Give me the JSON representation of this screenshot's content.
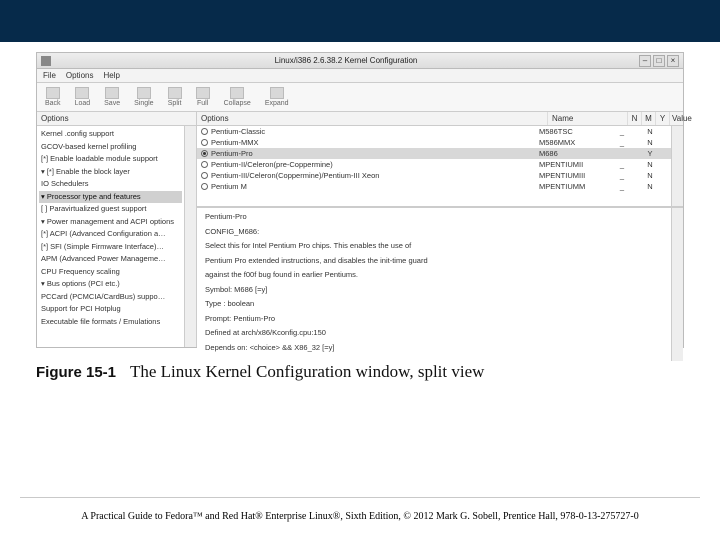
{
  "caption": {
    "figno": "Figure 15-1",
    "text": "The Linux Kernel Configuration window, split view"
  },
  "footer": "A Practical Guide to Fedora™ and Red Hat® Enterprise Linux®, Sixth Edition, © 2012 Mark G. Sobell, Prentice Hall, 978-0-13-275727-0",
  "window": {
    "title": "Linux/i386 2.6.38.2 Kernel Configuration",
    "menus": {
      "file": "File",
      "options": "Options",
      "help": "Help"
    },
    "toolbar": {
      "back": "Back",
      "load": "Load",
      "save": "Save",
      "single": "Single",
      "split": "Split",
      "full": "Full",
      "collapse": "Collapse",
      "expand": "Expand"
    },
    "left": {
      "header": "Options",
      "items": [
        "Kernel .config support",
        "GCOV-based kernel profiling",
        "[*] Enable loadable module support",
        "▾ [*] Enable the block layer",
        "    IO Schedulers",
        "▾ Processor type and features",
        "    [ ] Paravirtualized guest support",
        "▾ Power management and ACPI options",
        "    [*] ACPI (Advanced Configuration a…",
        "    [*] SFI (Simple Firmware Interface)…",
        "    APM (Advanced Power Manageme…",
        "    CPU Frequency scaling",
        "▾ Bus options (PCI etc.)",
        "    PCCard (PCMCIA/CardBus) suppo…",
        "    Support for PCI Hotplug",
        "Executable file formats / Emulations"
      ],
      "selected_index": 5
    },
    "right": {
      "header": {
        "options": "Options",
        "name": "Name",
        "n": "N",
        "m": "M",
        "y": "Y",
        "value": "Value"
      },
      "rows": [
        {
          "label": "Pentium-Classic",
          "name": "M586TSC",
          "n": "_",
          "m": "",
          "y": "N",
          "v": "",
          "sel": false
        },
        {
          "label": "Pentium-MMX",
          "name": "M586MMX",
          "n": "_",
          "m": "",
          "y": "N",
          "v": "",
          "sel": false
        },
        {
          "label": "Pentium-Pro",
          "name": "M686",
          "n": "",
          "m": "",
          "y": "Y",
          "v": "",
          "sel": true
        },
        {
          "label": "Pentium-II/Celeron(pre-Coppermine)",
          "name": "MPENTIUMII",
          "n": "_",
          "m": "",
          "y": "N",
          "v": "",
          "sel": false
        },
        {
          "label": "Pentium-III/Celeron(Coppermine)/Pentium-III Xeon",
          "name": "MPENTIUMIII",
          "n": "_",
          "m": "",
          "y": "N",
          "v": "",
          "sel": false
        },
        {
          "label": "Pentium M",
          "name": "MPENTIUMM",
          "n": "_",
          "m": "",
          "y": "N",
          "v": "",
          "sel": false
        }
      ],
      "detail": {
        "title": "Pentium-Pro",
        "config": "CONFIG_M686:",
        "body1": "Select this for Intel Pentium Pro chips. This enables the use of",
        "body2": "Pentium Pro extended instructions, and disables the init-time guard",
        "body3": "against the f00f bug found in earlier Pentiums.",
        "sym": "Symbol: M686 [=y]",
        "type": "Type  : boolean",
        "prompt": "Prompt: Pentium-Pro",
        "defat": "  Defined at arch/x86/Kconfig.cpu:150",
        "dep": "  Depends on: <choice> && X86_32 [=y]"
      }
    }
  }
}
